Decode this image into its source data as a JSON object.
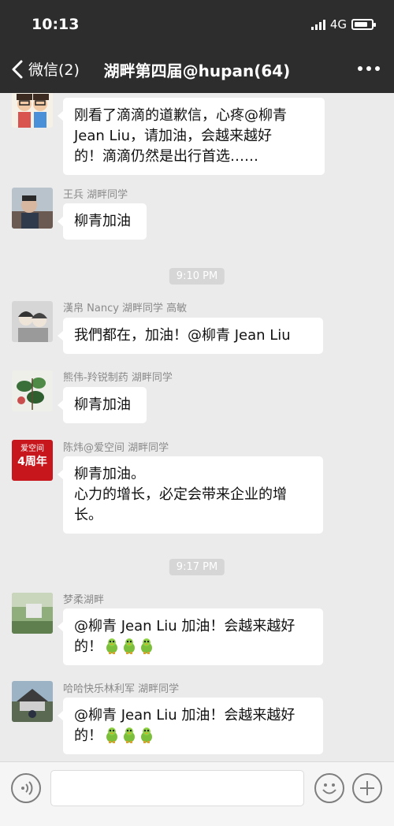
{
  "status_bar": {
    "time": "10:13",
    "network": "4G",
    "battery_level": 0.8
  },
  "nav": {
    "back_label": "微信(2)",
    "title": "湖畔第四届@hupan(64)"
  },
  "messages": [
    {
      "sender": "",
      "lines": [
        "刚看了滴滴的道歉信，心疼@柳青",
        "Jean Liu，请加油，会越来越好",
        "的！滴滴仍然是出行首选……"
      ]
    },
    {
      "sender": "王兵  湖畔同学",
      "lines": [
        "柳青加油"
      ]
    },
    {
      "sender": "漢帛 Nancy 湖畔同学 高敏",
      "lines": [
        "我們都在，加油！@柳青 Jean Liu"
      ]
    },
    {
      "sender": "熊伟-羚锐制药 湖畔同学",
      "lines": [
        "柳青加油"
      ]
    },
    {
      "sender": "陈炜@爱空间 湖畔同学",
      "avatar_text": [
        "爱空间",
        "4周年"
      ],
      "lines": [
        "柳青加油。",
        "心力的增长，必定会带来企业的增",
        "长。"
      ]
    },
    {
      "sender": "梦柔湖畔",
      "lines": [
        "@柳青 Jean Liu 加油！会越来越好",
        "的！"
      ],
      "trailing_emoji": [
        "green-bird-emoji",
        "green-bird-emoji",
        "green-bird-emoji"
      ]
    },
    {
      "sender": "哈哈快乐林利军 湖畔同学",
      "lines": [
        "@柳青 Jean Liu 加油！会越来越好",
        "的！"
      ],
      "trailing_emoji": [
        "green-bird-emoji",
        "green-bird-emoji",
        "green-bird-emoji"
      ]
    }
  ],
  "time_separators": [
    "9:10 PM",
    "9:17 PM"
  ],
  "input": {
    "placeholder": ""
  },
  "icons": [
    "back-chevron-icon",
    "more-icon",
    "voice-icon",
    "emoji-icon",
    "plus-icon"
  ],
  "colors": {
    "topbar": "#2d2d2d",
    "chat_background": "#ebebeb",
    "bubble": "#ffffff",
    "input_bar": "#f5f5f5"
  }
}
